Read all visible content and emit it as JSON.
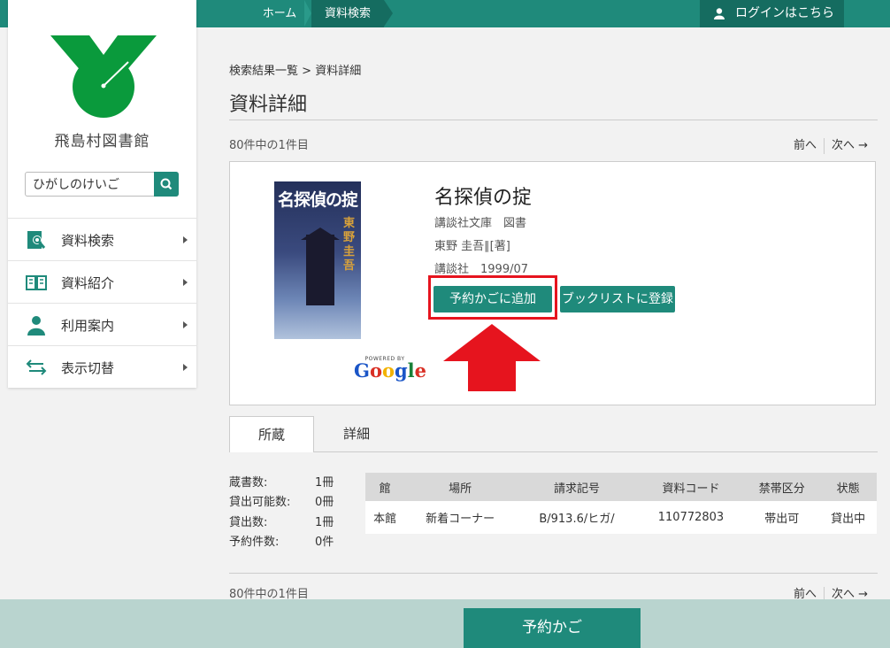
{
  "nav": {
    "home": "ホーム",
    "search": "資料検索",
    "login": "ログインはこちら"
  },
  "sidebar": {
    "library_name": "飛島村図書館",
    "search_value": "ひがしのけいご",
    "items": [
      {
        "label": "資料検索",
        "icon": "search-catalog-icon"
      },
      {
        "label": "資料紹介",
        "icon": "open-book-icon"
      },
      {
        "label": "利用案内",
        "icon": "user-guide-icon"
      },
      {
        "label": "表示切替",
        "icon": "switch-arrows-icon"
      }
    ]
  },
  "main": {
    "breadcrumb": [
      "検索結果一覧",
      ">",
      "資料詳細"
    ],
    "title": "資料詳細",
    "count": "80件中の1件目",
    "prev": "前へ",
    "next": "次へ →"
  },
  "book": {
    "cover_title": "名探偵の掟",
    "cover_author": "東野圭吾",
    "powered_by": "POWERED BY",
    "google": "Google",
    "title": "名探偵の掟",
    "series": "講談社文庫　図書",
    "author": "東野 圭吾∥[著]",
    "publisher": "講談社　1999/07",
    "reserve_button": "予約かごに追加",
    "booklist_button": "ブックリストに登録"
  },
  "tabs": [
    "所蔵",
    "詳細"
  ],
  "stats": [
    {
      "label": "蔵書数:",
      "value": "1冊"
    },
    {
      "label": "貸出可能数:",
      "value": "0冊"
    },
    {
      "label": "貸出数:",
      "value": "1冊"
    },
    {
      "label": "予約件数:",
      "value": "0件"
    }
  ],
  "holdings": {
    "headers": [
      "館",
      "場所",
      "請求記号",
      "資料コード",
      "禁帯区分",
      "状態"
    ],
    "rows": [
      [
        "本館",
        "新着コーナー",
        "B/913.6/ヒガ/",
        "110772803",
        "帯出可",
        "貸出中"
      ]
    ]
  },
  "footer": {
    "cart_button": "予約かご"
  },
  "colors": {
    "accent": "#1f8a7b",
    "accent_dark": "#156c60",
    "highlight": "#e6141e",
    "logo_green": "#0a9a3c"
  }
}
